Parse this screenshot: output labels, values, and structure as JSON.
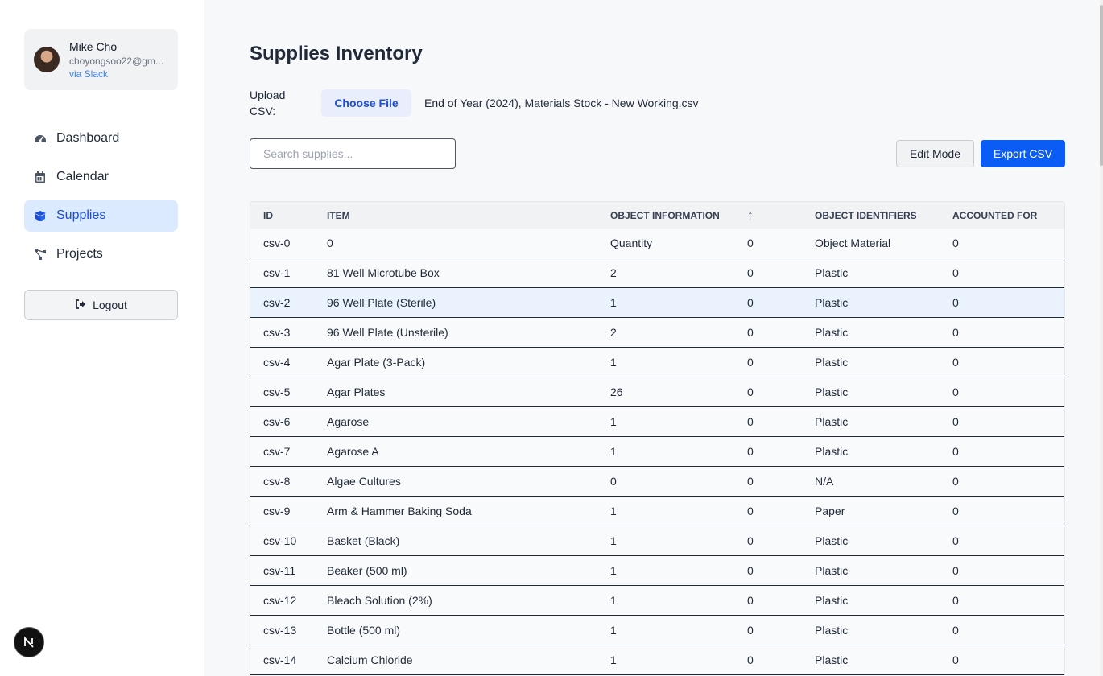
{
  "user": {
    "name": "Mike Cho",
    "email": "choyongsoo22@gm...",
    "via": "via Slack"
  },
  "nav": {
    "items": [
      {
        "label": "Dashboard",
        "icon": "gauge-icon"
      },
      {
        "label": "Calendar",
        "icon": "calendar-icon"
      },
      {
        "label": "Supplies",
        "icon": "boxes-icon",
        "active": true
      },
      {
        "label": "Projects",
        "icon": "project-diagram-icon"
      }
    ],
    "logout": "Logout"
  },
  "badge": "N",
  "page": {
    "title": "Supplies Inventory",
    "upload_label": "Upload CSV:",
    "choose_file": "Choose File",
    "file_name": "End of Year (2024), Materials Stock - New Working.csv",
    "search_placeholder": "Search supplies...",
    "edit_mode": "Edit Mode",
    "export_csv": "Export CSV"
  },
  "table": {
    "headers": [
      "ID",
      "ITEM",
      "OBJECT INFORMATION",
      "↑",
      "OBJECT IDENTIFIERS",
      "ACCOUNTED FOR"
    ],
    "rows": [
      [
        "csv-0",
        "0",
        "Quantity",
        "0",
        "Object Material",
        "0"
      ],
      [
        "csv-1",
        "81 Well Microtube Box",
        "2",
        "0",
        "Plastic",
        "0"
      ],
      [
        "csv-2",
        "96 Well Plate (Sterile)",
        "1",
        "0",
        "Plastic",
        "0"
      ],
      [
        "csv-3",
        "96 Well Plate (Unsterile)",
        "2",
        "0",
        "Plastic",
        "0"
      ],
      [
        "csv-4",
        "Agar Plate (3-Pack)",
        "1",
        "0",
        "Plastic",
        "0"
      ],
      [
        "csv-5",
        "Agar Plates",
        "26",
        "0",
        "Plastic",
        "0"
      ],
      [
        "csv-6",
        "Agarose",
        "1",
        "0",
        "Plastic",
        "0"
      ],
      [
        "csv-7",
        "Agarose A",
        "1",
        "0",
        "Plastic",
        "0"
      ],
      [
        "csv-8",
        "Algae Cultures",
        "0",
        "0",
        "N/A",
        "0"
      ],
      [
        "csv-9",
        "Arm & Hammer Baking Soda",
        "1",
        "0",
        "Paper",
        "0"
      ],
      [
        "csv-10",
        "Basket (Black)",
        "1",
        "0",
        "Plastic",
        "0"
      ],
      [
        "csv-11",
        "Beaker (500 ml)",
        "1",
        "0",
        "Plastic",
        "0"
      ],
      [
        "csv-12",
        "Bleach Solution (2%)",
        "1",
        "0",
        "Plastic",
        "0"
      ],
      [
        "csv-13",
        "Bottle (500 ml)",
        "1",
        "0",
        "Plastic",
        "0"
      ],
      [
        "csv-14",
        "Calcium Chloride",
        "1",
        "0",
        "Plastic",
        "0"
      ]
    ],
    "highlighted_row": 2
  },
  "colors": {
    "accent": "#0b5cf5",
    "nav_active_bg": "#dbeafe",
    "nav_active_text": "#1d4ed8",
    "row_highlight": "#eaf2fd"
  }
}
